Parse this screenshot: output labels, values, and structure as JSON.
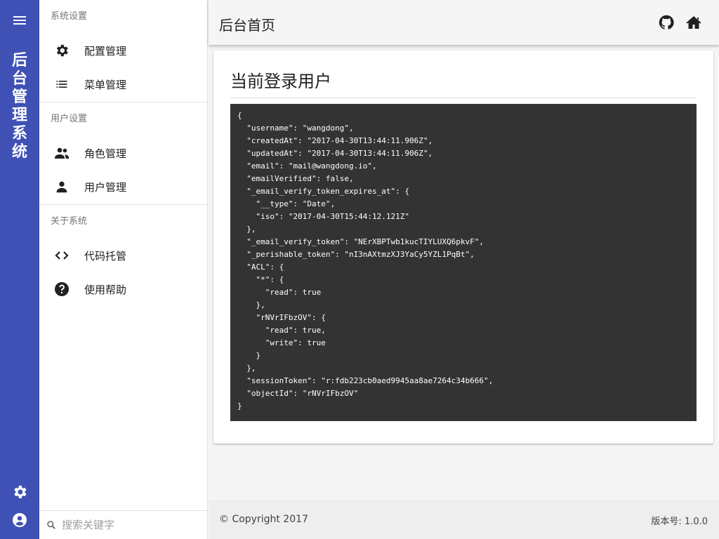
{
  "rail": {
    "app_title": "后台管理系统",
    "menu_icon": "menu-icon",
    "bottom_icons": [
      "settings-icon",
      "account-icon"
    ]
  },
  "sidebar": {
    "sections": [
      {
        "header": "系统设置",
        "items": [
          {
            "label": "配置管理",
            "icon": "gear-icon"
          },
          {
            "label": "菜单管理",
            "icon": "list-icon"
          }
        ]
      },
      {
        "header": "用户设置",
        "items": [
          {
            "label": "角色管理",
            "icon": "group-icon"
          },
          {
            "label": "用户管理",
            "icon": "person-icon"
          }
        ]
      },
      {
        "header": "关于系统",
        "items": [
          {
            "label": "代码托管",
            "icon": "code-icon"
          },
          {
            "label": "使用帮助",
            "icon": "help-icon"
          }
        ]
      }
    ],
    "search": {
      "placeholder": "搜索关键字",
      "value": ""
    }
  },
  "header": {
    "title": "后台首页",
    "icons": [
      "github-icon",
      "home-icon"
    ]
  },
  "main": {
    "card_title": "当前登录用户",
    "json_text": "{\n  \"username\": \"wangdong\",\n  \"createdAt\": \"2017-04-30T13:44:11.906Z\",\n  \"updatedAt\": \"2017-04-30T13:44:11.906Z\",\n  \"email\": \"mail@wangdong.io\",\n  \"emailVerified\": false,\n  \"_email_verify_token_expires_at\": {\n    \"__type\": \"Date\",\n    \"iso\": \"2017-04-30T15:44:12.121Z\"\n  },\n  \"_email_verify_token\": \"NErXBPTwb1kucTIYLUXQ6pkvF\",\n  \"_perishable_token\": \"nI3nAXtmzXJ3YaCy5YZL1PqBt\",\n  \"ACL\": {\n    \"*\": {\n      \"read\": true\n    },\n    \"rNVrIFbzOV\": {\n      \"read\": true,\n      \"write\": true\n    }\n  },\n  \"sessionToken\": \"r:fdb223cb0aed9945aa8ae7264c34b666\",\n  \"objectId\": \"rNVrIFbzOV\"\n}"
  },
  "footer": {
    "copyright": "© Copyright 2017",
    "version": "版本号: 1.0.0"
  },
  "colors": {
    "primary": "#3f51b5",
    "code_bg": "#333333"
  }
}
